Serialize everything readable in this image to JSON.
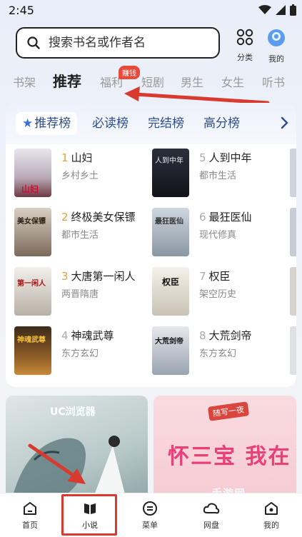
{
  "status_bar": {
    "time": "2:45"
  },
  "search": {
    "placeholder": "搜索书名或作者名"
  },
  "top_actions": {
    "category_label": "分类",
    "mine_label": "我的"
  },
  "channel_tabs": [
    {
      "label": "书架"
    },
    {
      "label": "推荐"
    },
    {
      "label": "福利"
    },
    {
      "label": "短剧"
    },
    {
      "label": "男生"
    },
    {
      "label": "女生"
    },
    {
      "label": "听书"
    }
  ],
  "earn_badge": "赚钱",
  "rank_tabs": [
    {
      "label": "推荐榜"
    },
    {
      "label": "必读榜"
    },
    {
      "label": "完结榜"
    },
    {
      "label": "高分榜"
    }
  ],
  "books": [
    {
      "rank": "1",
      "title": "山妇",
      "subtitle": "乡村乡土",
      "cover_text": "山妇"
    },
    {
      "rank": "5",
      "title": "人到中年",
      "subtitle": "都市生活",
      "cover_text": "人到中年"
    },
    {
      "rank": "2",
      "title": "终极美女保镖",
      "subtitle": "都市生活",
      "cover_text": "美女保镖"
    },
    {
      "rank": "6",
      "title": "最狂医仙",
      "subtitle": "现代修真",
      "cover_text": "最狂医仙"
    },
    {
      "rank": "3",
      "title": "大唐第一闲人",
      "subtitle": "两晋隋唐",
      "cover_text": "第一闲人"
    },
    {
      "rank": "7",
      "title": "权臣",
      "subtitle": "架空历史",
      "cover_text": "权臣"
    },
    {
      "rank": "4",
      "title": "神魂武尊",
      "subtitle": "东方玄幻",
      "cover_text": "神魂武尊"
    },
    {
      "rank": "8",
      "title": "大荒剑帝",
      "subtitle": "东方玄幻",
      "cover_text": "大荒剑帝"
    }
  ],
  "banners": {
    "left_logo": "UC浏览器",
    "right_tag": "随写一夜",
    "right_text": "怀三宝 我在"
  },
  "bottom_nav": [
    {
      "label": "首页"
    },
    {
      "label": "小说"
    },
    {
      "label": "菜单"
    },
    {
      "label": "网盘"
    },
    {
      "label": "我的"
    }
  ],
  "watermark": "手游网",
  "colors": {
    "accent_red": "#d93a2f",
    "rank_gold": "#e6a23c",
    "tab_blue": "#2c4c8c"
  }
}
